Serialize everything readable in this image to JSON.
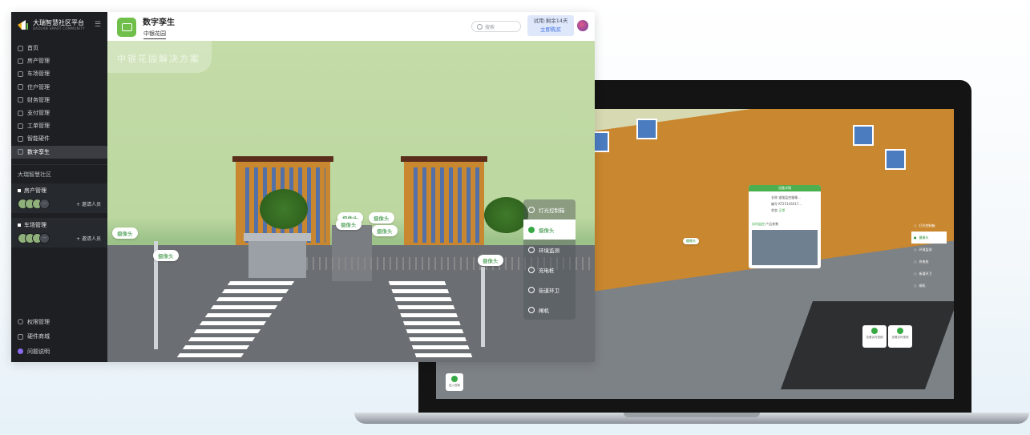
{
  "sidebar": {
    "brand": "大瑞智慧社区平台",
    "brand_sub": "DAZUAN SMART COMMUNITY",
    "menu": [
      "首页",
      "房产管理",
      "车场管理",
      "住户管理",
      "财务管理",
      "支付管理",
      "工单管理",
      "智能硬件",
      "数字孪生"
    ],
    "active_index": 8,
    "section_title": "大瑞智慧社区",
    "groups": [
      {
        "title": "房产管理",
        "invite": "+ 邀请人员"
      },
      {
        "title": "车场管理",
        "invite": "+ 邀请人员"
      }
    ],
    "bottom": [
      "权限管理",
      "硬件商城",
      "问题说明"
    ]
  },
  "header": {
    "title": "数字孪生",
    "tab": "中银花园",
    "search_placeholder": "搜索",
    "trial_status": "试用:剩余14天",
    "buy_label": "立即购买"
  },
  "scene": {
    "banner": "中银花园解决方案",
    "camera_label": "摄像头",
    "layers": [
      "灯光控制箱",
      "摄像头",
      "环境监测",
      "充电桩",
      "街道环卫",
      "闸机"
    ],
    "active_layer": 1
  },
  "laptop": {
    "layers": [
      "灯光控制箱",
      "摄像头",
      "环境监测",
      "充电桩",
      "街道环卫",
      "闸机"
    ],
    "active_layer": 1,
    "card": {
      "title": "设备详情",
      "rows": [
        [
          "名称",
          "道推监控摄像..."
        ],
        [
          "编号",
          "KT2514S417..."
        ],
        [
          "状态",
          "正常"
        ]
      ],
      "links": [
        "实时监控",
        "产品参数"
      ]
    },
    "camera_tag": "摄像头",
    "play_labels": [
      "查看实时视频",
      "查看实时视频"
    ],
    "corner_label": "进入视角"
  },
  "colors": {
    "accent": "#38a845",
    "sidebar_bg": "#1d1f22",
    "scene_sky": "#c4dca8"
  }
}
